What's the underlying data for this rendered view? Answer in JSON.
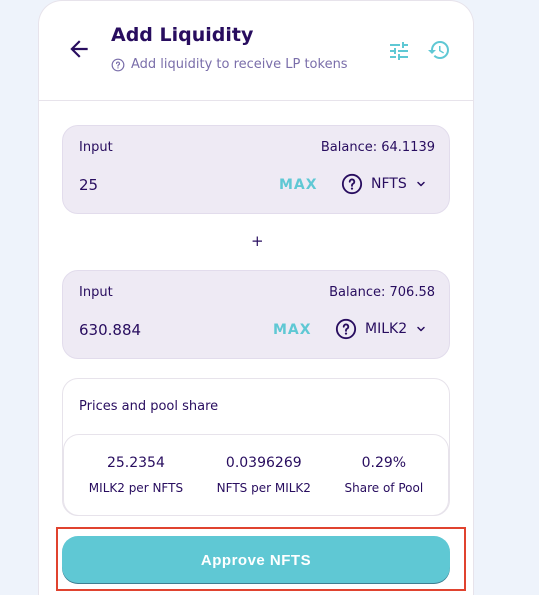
{
  "header": {
    "title": "Add Liquidity",
    "subtitle": "Add liquidity to receive LP tokens",
    "icons": {
      "back": "arrow-left-icon",
      "help": "question-circle-icon",
      "settings": "tune-icon",
      "history": "history-icon"
    }
  },
  "input_a": {
    "label": "Input",
    "balance": "Balance: 64.1139",
    "value": "25",
    "max_label": "MAX",
    "token": "NFTS"
  },
  "plus_sign": "+",
  "input_b": {
    "label": "Input",
    "balance": "Balance: 706.58",
    "value": "630.884",
    "max_label": "MAX",
    "token": "MILK2"
  },
  "pool": {
    "title": "Prices and pool share",
    "stats": [
      {
        "value": "25.2354",
        "label": "MILK2 per NFTS"
      },
      {
        "value": "0.0396269",
        "label": "NFTS per MILK2"
      },
      {
        "value": "0.29%",
        "label": "Share of Pool"
      }
    ]
  },
  "approve_button": {
    "label": "Approve NFTS"
  },
  "colors": {
    "accent": "#5fc8d4",
    "text": "#280d5f",
    "highlight_border": "#e0432f"
  }
}
